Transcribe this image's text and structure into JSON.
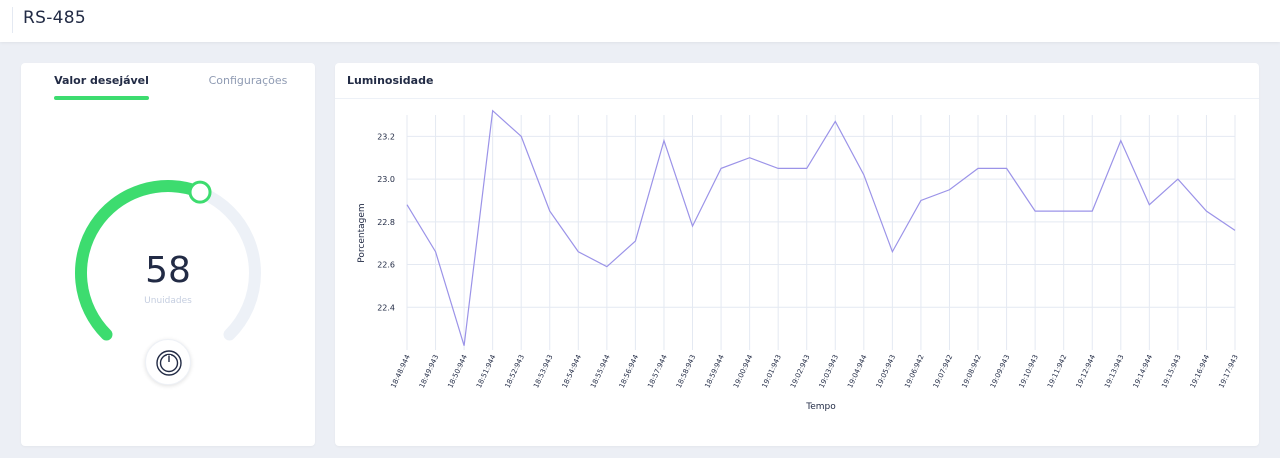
{
  "header": {
    "title": "RS-485"
  },
  "control_card": {
    "tabs": [
      {
        "label": "Valor desejável",
        "active": true
      },
      {
        "label": "Configurações",
        "active": false
      }
    ],
    "gauge": {
      "value": "58",
      "unit": "Unuidades",
      "fraction": 0.58
    },
    "accent_color": "#3ddc6f",
    "power_button_icon": "power-icon"
  },
  "chart_card": {
    "title": "Luminosidade",
    "line_color": "#9b93e8"
  },
  "chart_data": {
    "type": "line",
    "title": "",
    "xlabel": "Tempo",
    "ylabel": "Porcentagem",
    "ylim": [
      22.2,
      23.3
    ],
    "yticks": [
      22.4,
      22.6,
      22.8,
      23.0,
      23.2
    ],
    "ytick_labels": [
      "22.4",
      "22.6",
      "22.8",
      "23.0",
      "23.2"
    ],
    "grid": true,
    "categories": [
      "18:48:944",
      "18:49:943",
      "18:50:944",
      "18:51:944",
      "18:52:943",
      "18:53:943",
      "18:54:944",
      "18:55:944",
      "18:56:944",
      "18:57:944",
      "18:58:943",
      "18:59:944",
      "19:00:944",
      "19:01:943",
      "19:02:943",
      "19:03:943",
      "19:04:944",
      "19:05:943",
      "19:06:942",
      "19:07:942",
      "19:08:942",
      "19:09:943",
      "19:10:943",
      "19:11:942",
      "19:12:944",
      "19:13:943",
      "19:14:944",
      "19:15:943",
      "19:16:944",
      "19:17:943"
    ],
    "series": [
      {
        "values": [
          22.88,
          22.66,
          22.22,
          23.32,
          23.2,
          22.85,
          22.66,
          22.59,
          22.71,
          23.18,
          22.78,
          23.05,
          23.1,
          23.05,
          23.05,
          23.27,
          23.02,
          22.66,
          22.9,
          22.95,
          23.05,
          23.05,
          22.85,
          22.85,
          22.85,
          23.18,
          22.88,
          23.0,
          22.85,
          22.76
        ]
      }
    ]
  }
}
